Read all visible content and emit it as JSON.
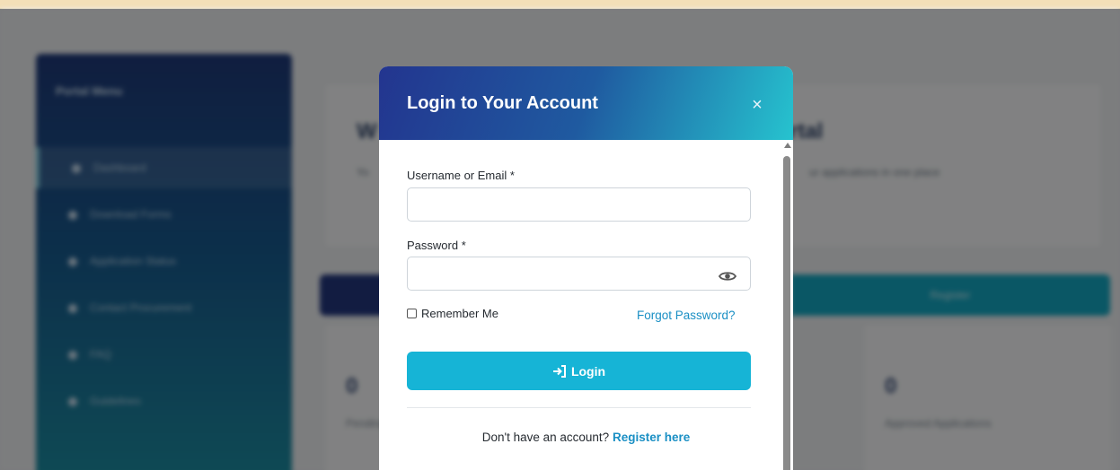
{
  "background": {
    "sidebar": {
      "title": "Portal Menu",
      "items": [
        {
          "label": "Dashboard",
          "active": true
        },
        {
          "label": "Download Forms"
        },
        {
          "label": "Application Status"
        },
        {
          "label": "Contact Procurement"
        },
        {
          "label": "FAQ"
        },
        {
          "label": "Guidelines"
        }
      ]
    },
    "welcome": {
      "title_left": "W",
      "title_right": "rtal",
      "subtitle_left": "Yo",
      "subtitle_right": "ur applications in one place"
    },
    "register_button_label": "Register",
    "stats": [
      {
        "value": "0",
        "label": "Pending Applications"
      },
      {
        "value": "0",
        "label": "Approved Applications"
      }
    ]
  },
  "modal": {
    "title": "Login to Your Account",
    "close_glyph": "×",
    "username_label": "Username or Email *",
    "username_value": "",
    "password_label": "Password *",
    "password_value": "",
    "remember_label": "Remember Me",
    "forgot_label": "Forgot Password?",
    "login_label": "Login",
    "footer_prompt": "Don't have an account?",
    "register_link": "Register here"
  },
  "colors": {
    "header_gradient_start": "#23358f",
    "header_gradient_end": "#26c3cf",
    "login_button": "#16b4d6",
    "link": "#1a8fc4"
  },
  "icons": {
    "close": "close-icon",
    "password_toggle": "eye-icon",
    "login": "sign-in-icon"
  }
}
